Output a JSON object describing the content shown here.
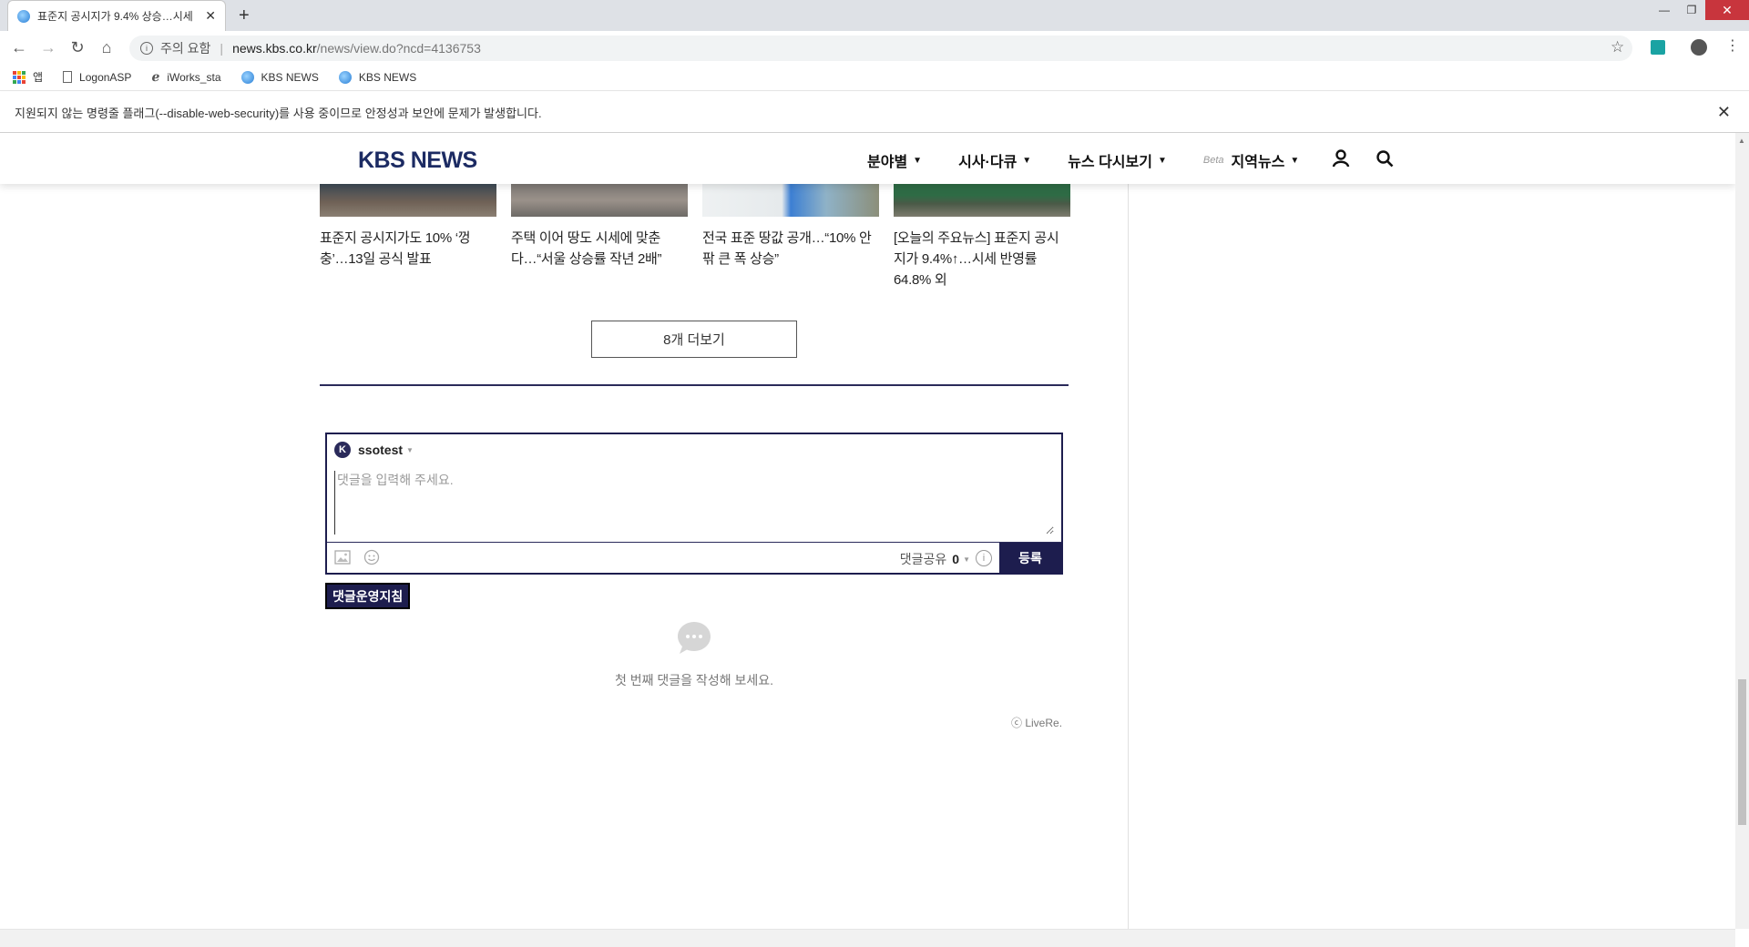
{
  "browser": {
    "tab_title": "표준지 공시지가 9.4% 상승…시세",
    "new_tab": "+",
    "url_security": "주의 요함",
    "url_host": "news.kbs.co.kr",
    "url_path": "/news/view.do?ncd=4136753",
    "bookmarks": [
      {
        "label": "앱",
        "icon": "apps-icon"
      },
      {
        "label": "LogonASP",
        "icon": "page-icon"
      },
      {
        "label": "iWorks_sta",
        "icon": "ie-icon"
      },
      {
        "label": "KBS NEWS",
        "icon": "kbs-favicon"
      },
      {
        "label": "KBS NEWS",
        "icon": "kbs-favicon"
      }
    ],
    "warning": "지원되지 않는 명령줄 플래그(--disable-web-security)를 사용 중이므로 안정성과 보안에 문제가 발생합니다."
  },
  "site": {
    "logo": "KBS NEWS",
    "nav": [
      {
        "label": "분야별"
      },
      {
        "label": "시사·다큐"
      },
      {
        "label": "뉴스 다시보기"
      },
      {
        "label": "지역뉴스",
        "badge": "Beta"
      }
    ]
  },
  "related": [
    {
      "title": "표준지 공시지가도 10% ‘껑충’…13일 공식 발표"
    },
    {
      "title": "주택 이어 땅도 시세에 맞춘다…“서울 상승률 작년 2배”"
    },
    {
      "title": "전국 표준 땅값 공개…“10% 안팎 큰 폭 상승”"
    },
    {
      "title": "[오늘의 주요뉴스] 표준지 공시지가 9.4%↑…시세 반영률 64.8% 외"
    }
  ],
  "more_label": "8개 더보기",
  "comment": {
    "username": "ssotest",
    "avatar_letter": "K",
    "placeholder": "댓글을 입력해 주세요.",
    "share_label": "댓글공유",
    "share_count": "0",
    "submit_label": "등록",
    "policy_label": "댓글운영지침",
    "empty_message": "첫 번째 댓글을 작성해 보세요.",
    "powered_by": "ⓒ LiveRe."
  },
  "colors": {
    "brand_navy": "#1d1d4e",
    "logo_blue": "#1c2b63"
  }
}
